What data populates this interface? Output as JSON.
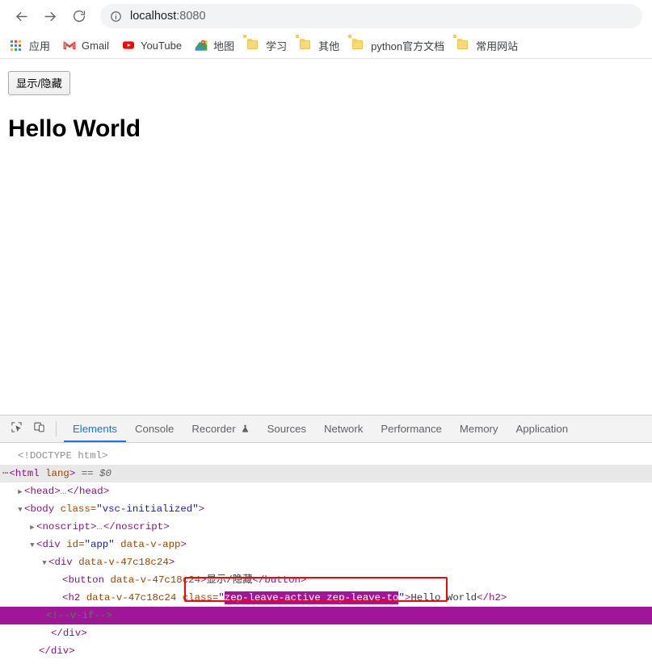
{
  "browser": {
    "nav": {
      "back_icon": "arrow-left-icon",
      "forward_icon": "arrow-right-icon",
      "reload_icon": "reload-icon"
    },
    "omnibox": {
      "site_info_icon": "info-circle-icon",
      "host": "localhost",
      "port": ":8080",
      "url": "localhost:8080"
    },
    "bookmarks": [
      {
        "label": "应用",
        "icon": "apps-grid-icon"
      },
      {
        "label": "Gmail",
        "icon": "gmail-icon"
      },
      {
        "label": "YouTube",
        "icon": "youtube-icon"
      },
      {
        "label": "地图",
        "icon": "google-maps-icon"
      },
      {
        "label": "学习",
        "icon": "folder-icon"
      },
      {
        "label": "其他",
        "icon": "folder-icon"
      },
      {
        "label": "python官方文档",
        "icon": "folder-icon"
      },
      {
        "label": "常用网站",
        "icon": "folder-icon"
      }
    ]
  },
  "page": {
    "toggle_button_label": "显示/隐藏",
    "heading": "Hello World"
  },
  "devtools": {
    "toolbar": {
      "inspect_icon": "inspect-element-icon",
      "device_toolbar_icon": "device-toolbar-icon"
    },
    "tabs": [
      {
        "label": "Elements",
        "active": true
      },
      {
        "label": "Console",
        "active": false
      },
      {
        "label": "Recorder",
        "active": false,
        "icon": "flask-experimental-icon"
      },
      {
        "label": "Sources",
        "active": false
      },
      {
        "label": "Network",
        "active": false
      },
      {
        "label": "Performance",
        "active": false
      },
      {
        "label": "Memory",
        "active": false
      },
      {
        "label": "Application",
        "active": false
      }
    ],
    "dom": {
      "doctype": "<!DOCTYPE html>",
      "html_open_tag": "<html lang>",
      "html_selected_marker": "== $0",
      "head_node": "<head>…</head>",
      "body_open": "<body class=\"vsc-initialized\">",
      "noscript_node": "<noscript>…</noscript>",
      "div_app_open": "<div id=\"app\" data-v-app>",
      "div_scoped_open": "<div data-v-47c18c24>",
      "button_line": "<button data-v-47c18c24>显示/隐藏</button>",
      "h2_prefix": "<h2 data-v-47c18c24",
      "h2_class_attr": "class=",
      "h2_class_value": "zep-leave-active zep-leave-to",
      "h2_text": "Hello World",
      "h2_close": "</h2>",
      "comment_v_if": "<!--v-if-->",
      "div_close_inner": "</div>",
      "div_close_outer": "</div>",
      "tag_names": {
        "html": "html",
        "head": "head",
        "body": "body",
        "noscript": "noscript",
        "div": "div",
        "button": "button",
        "h2": "h2"
      },
      "attrs": {
        "lang": "lang",
        "class": "class",
        "id": "id",
        "data_v_app": "data-v-app",
        "data_v_scope": "data-v-47c18c24"
      },
      "values": {
        "vsc_initialized": "vsc-initialized",
        "app": "app"
      }
    },
    "annotation": {
      "red_box_target": "h2-class-attribute",
      "highlight_color": "#ff0000",
      "selection_color": "#a1159b"
    }
  },
  "colors": {
    "accent": "#1a73e8",
    "chrome_bg": "#ffffff",
    "toolbar_bg": "#f3f3f3",
    "tag_purple": "#881280",
    "attr_orange": "#994500",
    "value_blue": "#1a1aa6",
    "comment_green": "#236e25"
  }
}
